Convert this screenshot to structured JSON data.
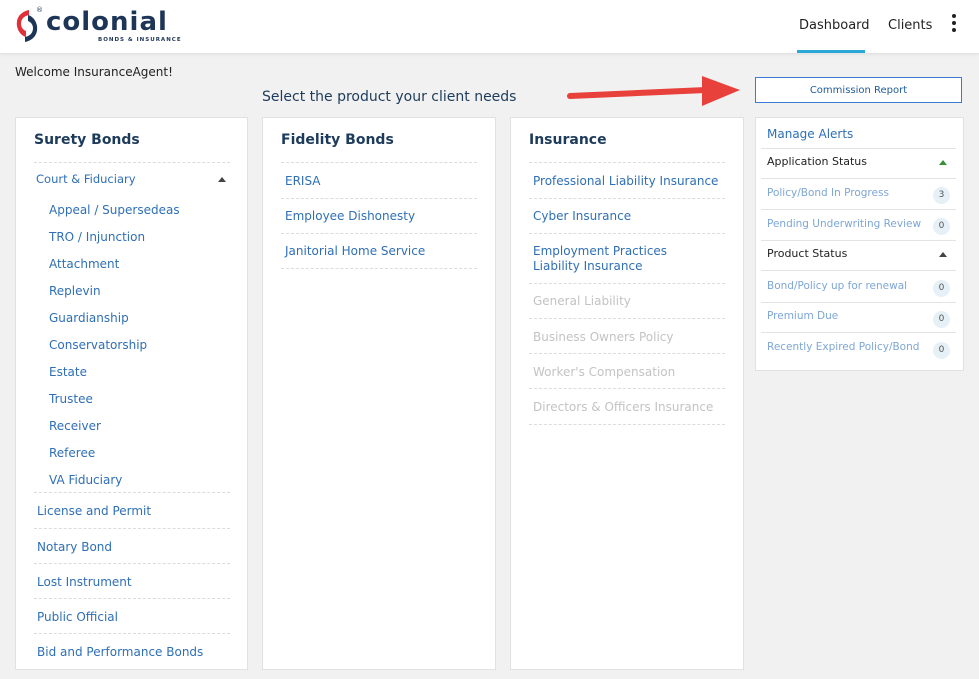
{
  "header": {
    "brand": "colonial",
    "brand_sub": "BONDS & INSURANCE",
    "brand_reg": "®",
    "nav": [
      {
        "label": "Dashboard",
        "active": true
      },
      {
        "label": "Clients",
        "active": false
      }
    ],
    "menu_icon": "more-vert-icon",
    "accent_color": "#2aa8d8",
    "logo_colors": {
      "red": "#e0303a",
      "navy": "#1d3557"
    }
  },
  "welcome": "Welcome InsuranceAgent!",
  "heading": "Select the product your client needs",
  "commission_button": "Commission Report",
  "surety": {
    "title": "Surety Bonds",
    "group": {
      "label": "Court & Fiduciary",
      "expanded": true,
      "items": [
        "Appeal / Supersedeas",
        "TRO / Injunction",
        "Attachment",
        "Replevin",
        "Guardianship",
        "Conservatorship",
        "Estate",
        "Trustee",
        "Receiver",
        "Referee",
        "VA Fiduciary"
      ]
    },
    "others": [
      "License and Permit",
      "Notary Bond",
      "Lost Instrument",
      "Public Official",
      "Bid and Performance Bonds"
    ]
  },
  "fidelity": {
    "title": "Fidelity Bonds",
    "items": [
      "ERISA",
      "Employee Dishonesty",
      "Janitorial Home Service"
    ]
  },
  "insurance": {
    "title": "Insurance",
    "items": [
      {
        "label": "Professional Liability Insurance",
        "enabled": true
      },
      {
        "label": "Cyber Insurance",
        "enabled": true
      },
      {
        "label": "Employment Practices Liability Insurance",
        "enabled": true
      },
      {
        "label": "General Liability",
        "enabled": false
      },
      {
        "label": "Business Owners Policy",
        "enabled": false
      },
      {
        "label": "Worker's Compensation",
        "enabled": false
      },
      {
        "label": "Directors & Officers Insurance",
        "enabled": false
      }
    ]
  },
  "alerts": {
    "title": "Manage Alerts",
    "application_status": {
      "label": "Application Status",
      "items": [
        {
          "label": "Policy/Bond In Progress",
          "count": "3"
        },
        {
          "label": "Pending Underwriting Review",
          "count": "0"
        }
      ]
    },
    "product_status": {
      "label": "Product Status",
      "items": [
        {
          "label": "Bond/Policy up for renewal",
          "count": "0"
        },
        {
          "label": "Premium Due",
          "count": "0"
        },
        {
          "label": "Recently Expired Policy/Bond",
          "count": "0"
        }
      ]
    }
  },
  "annotation_arrow_color": "#e8403a"
}
